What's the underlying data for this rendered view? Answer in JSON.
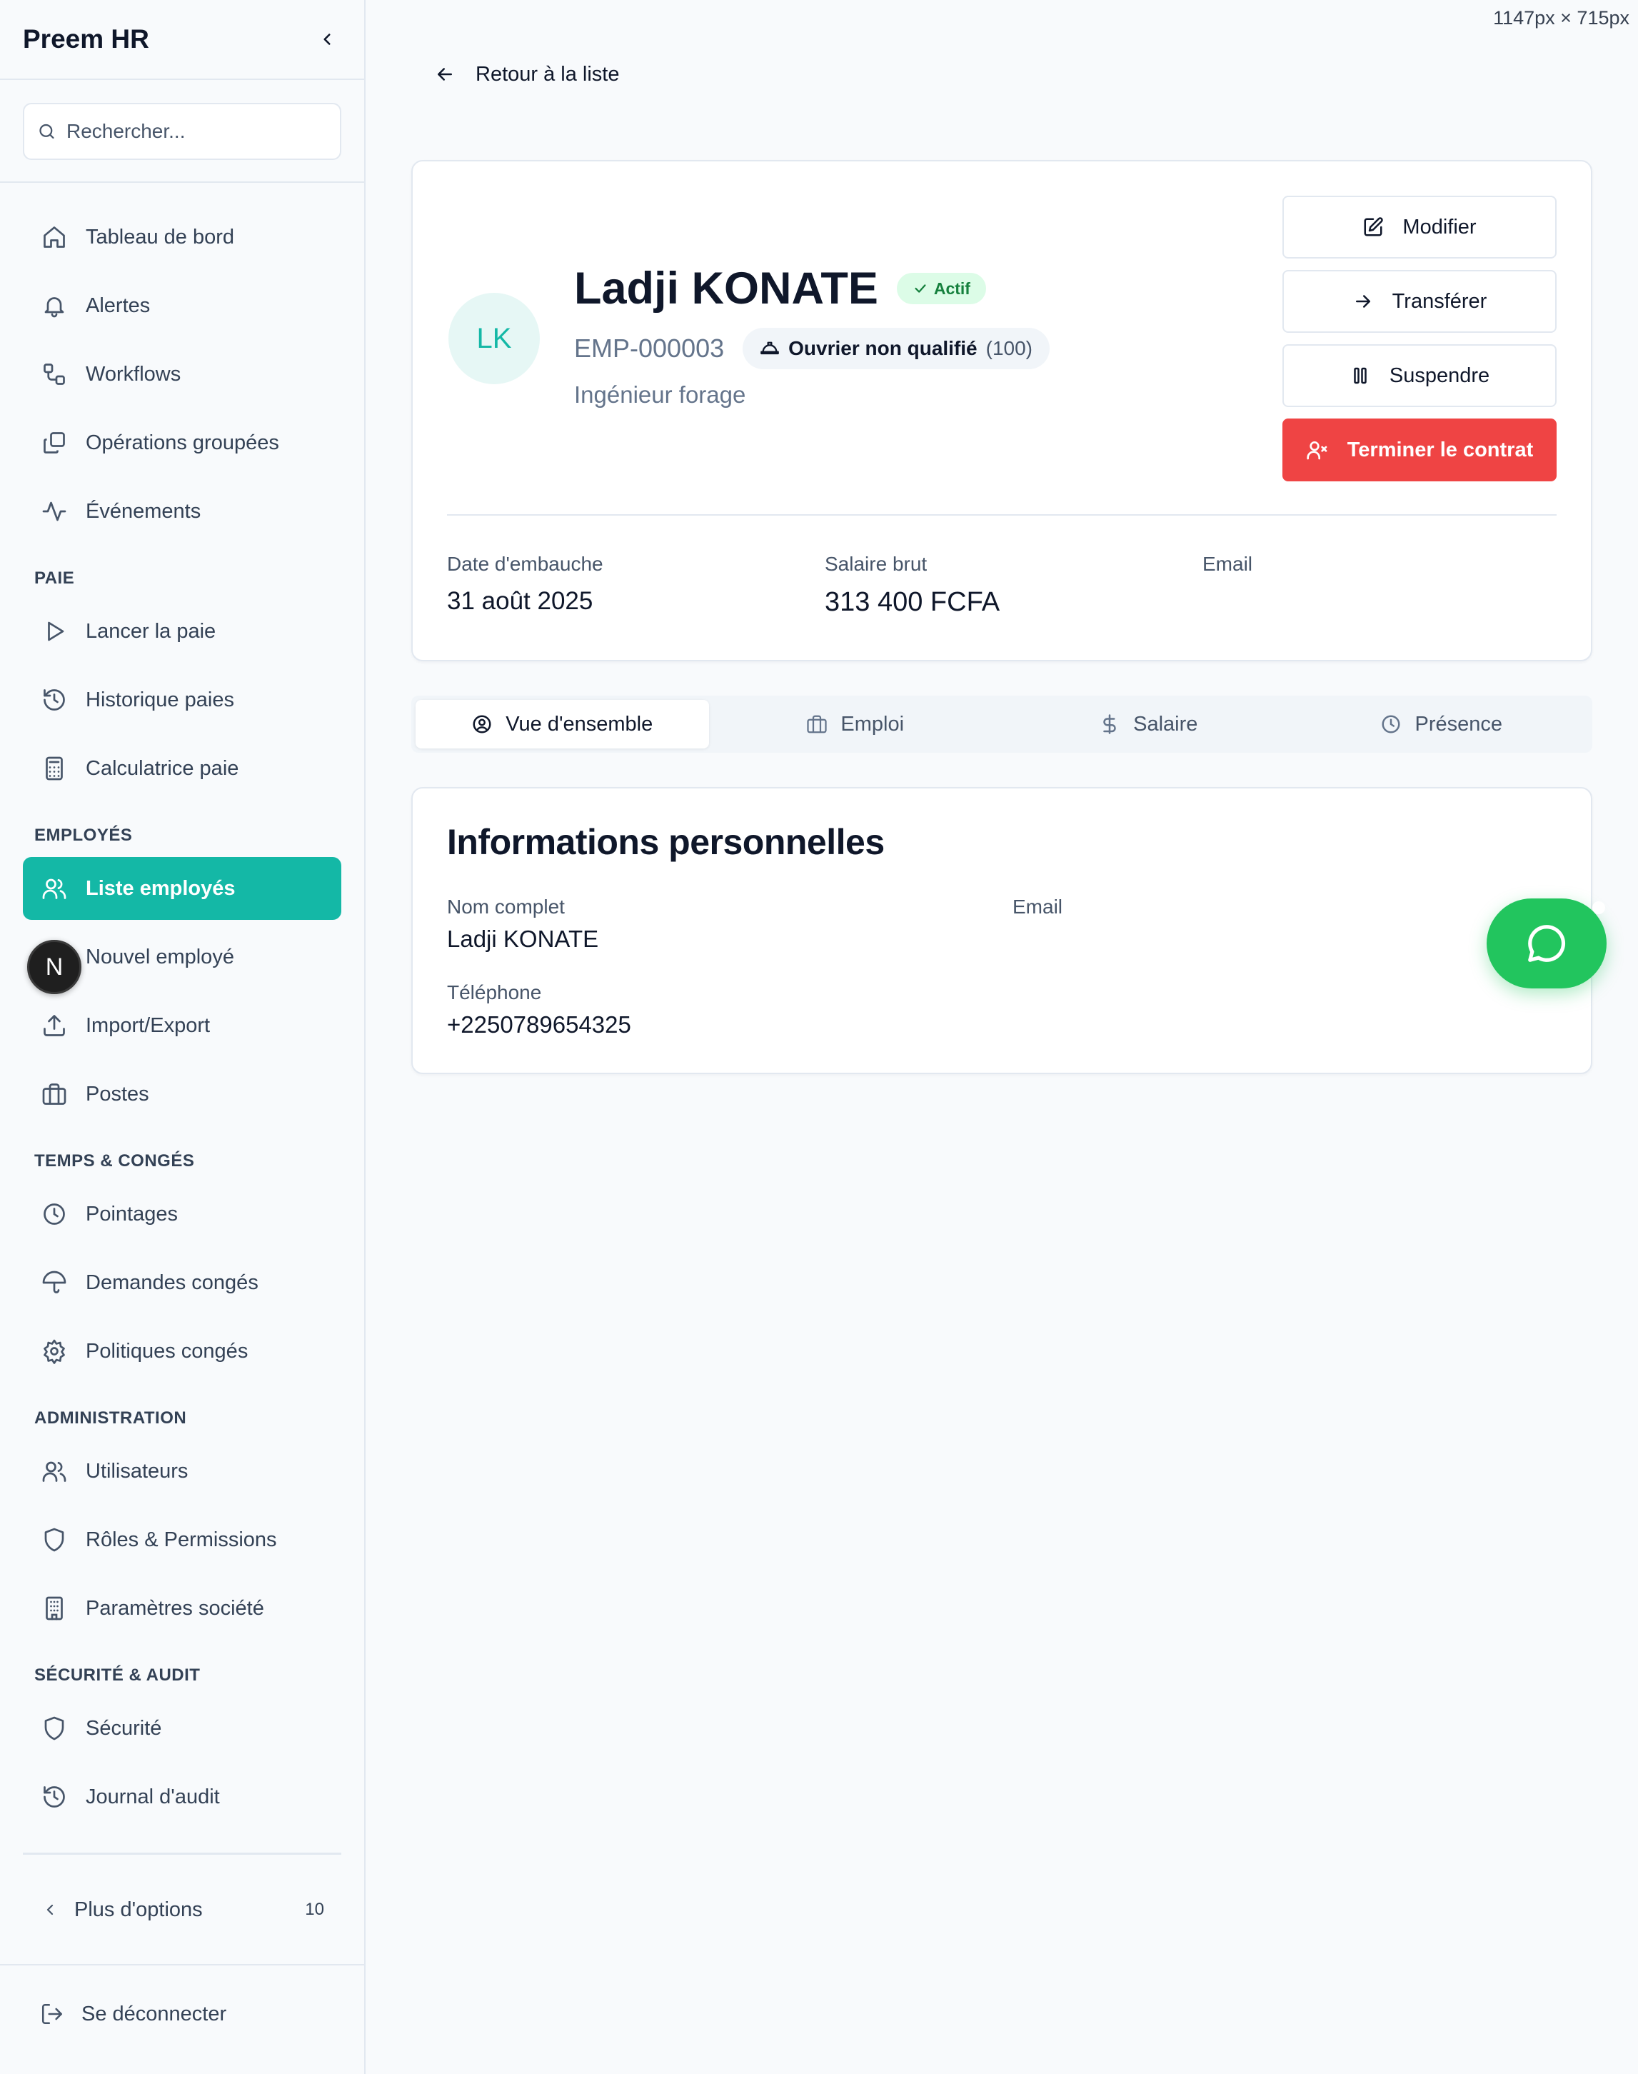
{
  "viewport_label": "1147px × 715px",
  "sidebar": {
    "title": "Preem HR",
    "search_placeholder": "Rechercher...",
    "items_top": [
      {
        "label": "Tableau de bord",
        "icon": "home-icon"
      },
      {
        "label": "Alertes",
        "icon": "bell-icon"
      },
      {
        "label": "Workflows",
        "icon": "workflow-icon"
      },
      {
        "label": "Opérations groupées",
        "icon": "copy-icon"
      },
      {
        "label": "Événements",
        "icon": "activity-icon"
      }
    ],
    "sections": {
      "paie": "PAIE",
      "employes": "EMPLOYÉS",
      "temps": "TEMPS & CONGÉS",
      "admin": "ADMINISTRATION",
      "securite": "SÉCURITÉ & AUDIT"
    },
    "paie_items": [
      {
        "label": "Lancer la paie",
        "icon": "play-icon"
      },
      {
        "label": "Historique paies",
        "icon": "history-icon"
      },
      {
        "label": "Calculatrice paie",
        "icon": "calculator-icon"
      }
    ],
    "employes_items": [
      {
        "label": "Liste employés",
        "icon": "users-icon",
        "active": true
      },
      {
        "label": "Nouvel employé",
        "icon": "user-plus-icon"
      },
      {
        "label": "Import/Export",
        "icon": "upload-icon"
      },
      {
        "label": "Postes",
        "icon": "briefcase-icon"
      }
    ],
    "temps_items": [
      {
        "label": "Pointages",
        "icon": "clock-icon"
      },
      {
        "label": "Demandes congés",
        "icon": "umbrella-icon"
      },
      {
        "label": "Politiques congés",
        "icon": "settings-icon"
      }
    ],
    "admin_items": [
      {
        "label": "Utilisateurs",
        "icon": "users-icon"
      },
      {
        "label": "Rôles & Permissions",
        "icon": "shield-icon"
      },
      {
        "label": "Paramètres société",
        "icon": "building-icon"
      }
    ],
    "securite_items": [
      {
        "label": "Sécurité",
        "icon": "shield-icon"
      },
      {
        "label": "Journal d'audit",
        "icon": "history-icon"
      }
    ],
    "more": {
      "label": "Plus d'options",
      "count": "10"
    },
    "logout": "Se déconnecter",
    "dev_badge": "N"
  },
  "back_link": "Retour à la liste",
  "employee": {
    "initials": "LK",
    "name": "Ladji KONATE",
    "status": "Actif",
    "id": "EMP-000003",
    "grade_name": "Ouvrier non qualifié",
    "grade_code": "(100)",
    "job_title": "Ingénieur forage"
  },
  "actions": {
    "edit": "Modifier",
    "transfer": "Transférer",
    "suspend": "Suspendre",
    "terminate": "Terminer le contrat"
  },
  "summary": {
    "hire_date_label": "Date d'embauche",
    "hire_date": "31 août 2025",
    "salary_label": "Salaire brut",
    "salary": "313 400 FCFA",
    "email_label": "Email"
  },
  "tabs": [
    {
      "label": "Vue d'ensemble",
      "icon": "user-circle-icon",
      "active": true
    },
    {
      "label": "Emploi",
      "icon": "briefcase-icon"
    },
    {
      "label": "Salaire",
      "icon": "dollar-icon"
    },
    {
      "label": "Présence",
      "icon": "clock-icon"
    }
  ],
  "personal": {
    "title": "Informations personnelles",
    "full_name_label": "Nom complet",
    "full_name": "Ladji KONATE",
    "email_label": "Email",
    "phone_label": "Téléphone",
    "phone": "+2250789654325"
  },
  "colors": {
    "accent": "#14b8a6",
    "danger": "#ef4444",
    "success_bg": "#dcfce7",
    "success_text": "#15803d",
    "chat": "#22c55e"
  }
}
